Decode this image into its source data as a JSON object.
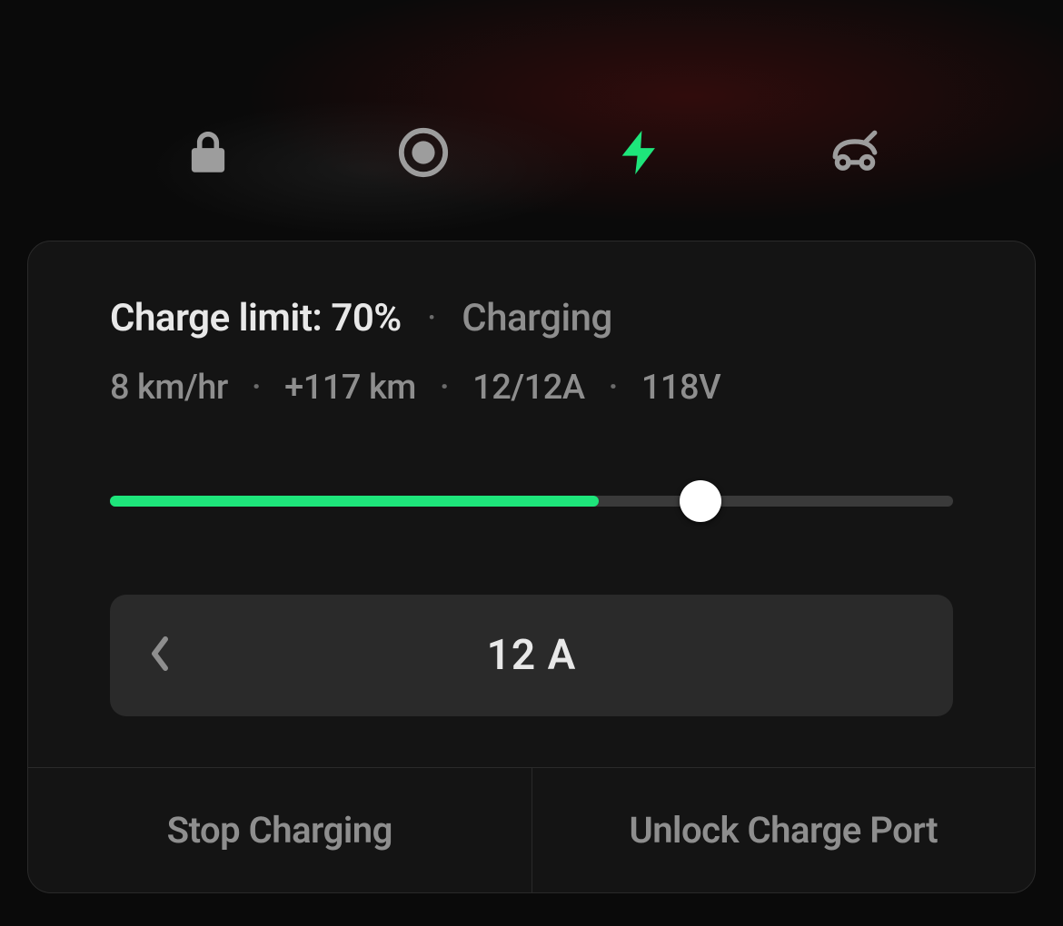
{
  "tabs": {
    "lock": "lock-icon",
    "record": "record-icon",
    "charge": "bolt-icon",
    "frunk": "frunk-icon",
    "active": "charge"
  },
  "charge": {
    "limit_label": "Charge limit: 70%",
    "status": "Charging",
    "stats": {
      "rate": "8 km/hr",
      "added": "+117 km",
      "amps": "12/12A",
      "voltage": "118V"
    },
    "slider": {
      "fill_percent": 58,
      "thumb_percent": 70
    },
    "amp_stepper": {
      "value": "12 A"
    },
    "actions": {
      "stop": "Stop Charging",
      "unlock": "Unlock Charge Port"
    }
  },
  "colors": {
    "accent": "#1EE57B"
  }
}
